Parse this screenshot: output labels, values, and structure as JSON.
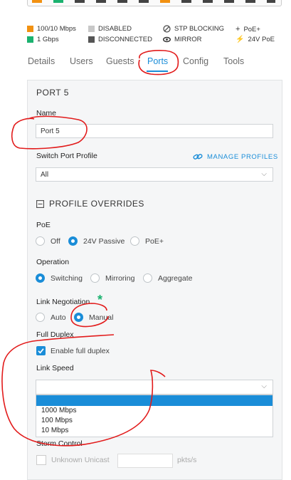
{
  "legend": {
    "speed_100": "100/10 Mbps",
    "speed_1g": "1 Gbps",
    "disabled": "DISABLED",
    "disconnected": "DISCONNECTED",
    "stp_blocking": "STP BLOCKING",
    "mirror": "MIRROR",
    "poe_plus": "PoE+",
    "poe_24v": "24V PoE",
    "colors": {
      "speed_100": "#f29111",
      "speed_1g": "#1bb26f",
      "disabled": "#c8c8c8",
      "disconnected": "#555555"
    }
  },
  "tabs": [
    {
      "label": "Details"
    },
    {
      "label": "Users"
    },
    {
      "label": "Guests"
    },
    {
      "label": "Ports"
    },
    {
      "label": "Config"
    },
    {
      "label": "Tools"
    }
  ],
  "panel": {
    "title": "PORT 5",
    "name_label": "Name",
    "name_value": "Port 5",
    "profile_label": "Switch Port Profile",
    "manage_profiles": "MANAGE PROFILES",
    "profile_value": "All",
    "overrides_label": "PROFILE OVERRIDES",
    "poe_label": "PoE",
    "poe_options": [
      "Off",
      "24V Passive",
      "PoE+"
    ],
    "operation_label": "Operation",
    "operation_options": [
      "Switching",
      "Mirroring",
      "Aggregate"
    ],
    "link_neg_label": "Link Negotiation",
    "link_neg_options": [
      "Auto",
      "Manual"
    ],
    "full_duplex_label": "Full Duplex",
    "full_duplex_checkbox": "Enable full duplex",
    "link_speed_label": "Link Speed",
    "link_speed_options": [
      "1000 Mbps",
      "100 Mbps",
      "10 Mbps"
    ],
    "storm_label": "Storm Control",
    "unknown_unicast": "Unknown Unicast",
    "pkts_unit": "pkts/s"
  }
}
